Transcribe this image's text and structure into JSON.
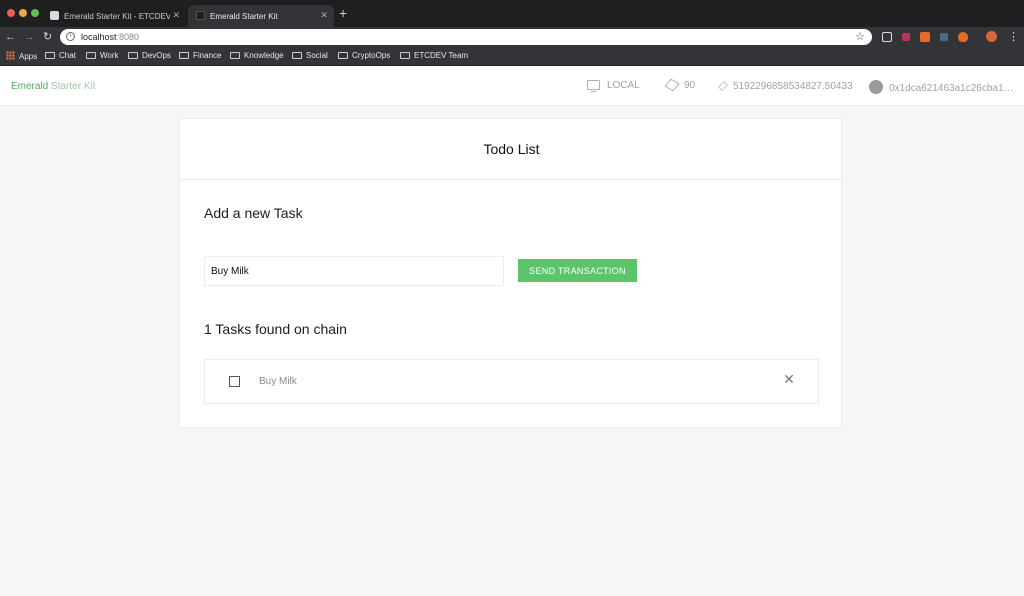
{
  "browser": {
    "tabs": [
      {
        "title": "Emerald Starter Kit - ETCDEV"
      },
      {
        "title": "Emerald Starter Kit"
      }
    ],
    "url_host": "localhost",
    "url_port": ":8080",
    "bookmarks": [
      "Apps",
      "Chat",
      "Work",
      "DevOps",
      "Finance",
      "Knowledge",
      "Social",
      "CryptoOps",
      "ETCDEV Team"
    ]
  },
  "header": {
    "brand_primary": "Emerald",
    "brand_secondary": "Starter Kit",
    "network": "LOCAL",
    "block": "90",
    "balance": "5192296858534827.50433",
    "account": "0x1dca621463a1c26cba1…"
  },
  "card": {
    "title": "Todo List",
    "add_title": "Add a new Task",
    "input_value": "Buy Milk",
    "send_label": "SEND TRANSACTION",
    "tasks_title": "1 Tasks found on chain",
    "tasks": [
      {
        "text": "Buy Milk",
        "done": false
      }
    ]
  },
  "colors": {
    "accent": "#5cc46a",
    "brand": "#4caf62"
  }
}
